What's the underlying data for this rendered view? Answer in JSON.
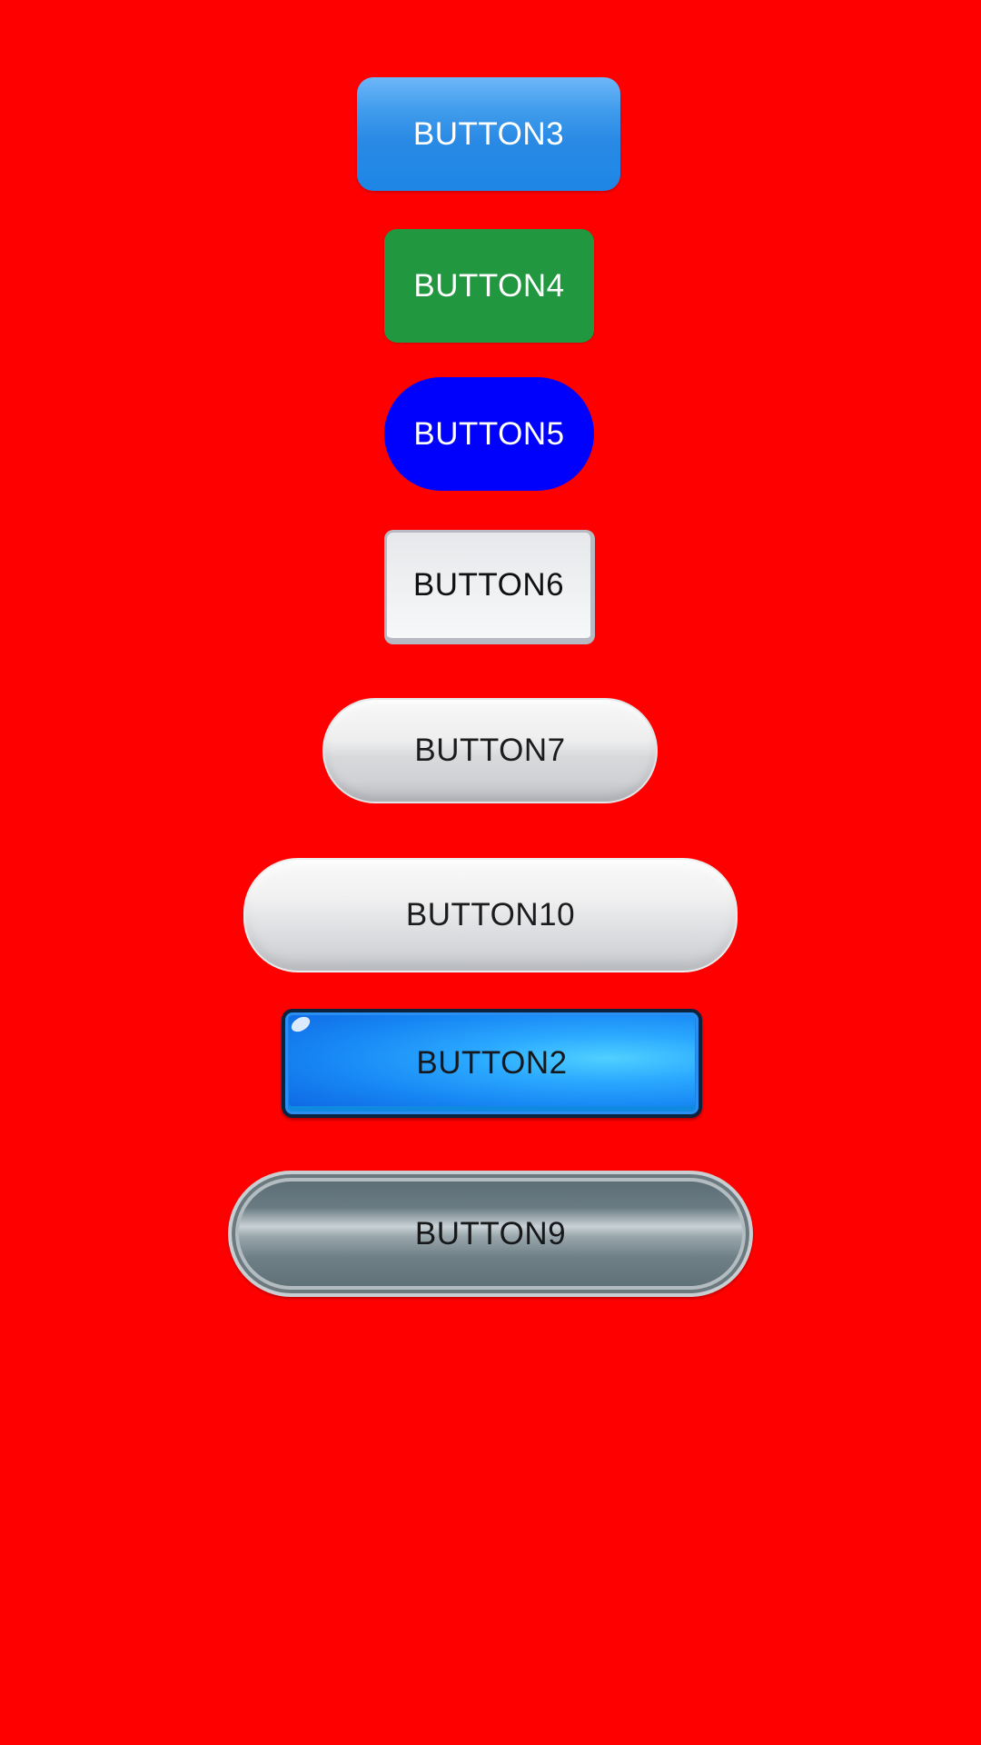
{
  "screen": {
    "background_color": "#ff0000"
  },
  "buttons": [
    {
      "id": "b3",
      "label": "BUTTON3",
      "color": "#2a8ae5"
    },
    {
      "id": "b4",
      "label": "BUTTON4",
      "color": "#21973f"
    },
    {
      "id": "b5",
      "label": "BUTTON5",
      "color": "#0000fd"
    },
    {
      "id": "b6",
      "label": "BUTTON6",
      "color": "#eef0f2"
    },
    {
      "id": "b7",
      "label": "BUTTON7",
      "color": "#eeeeef"
    },
    {
      "id": "b10",
      "label": "BUTTON10",
      "color": "#f0f0f1"
    },
    {
      "id": "b2",
      "label": "BUTTON2",
      "color": "#1684f3"
    },
    {
      "id": "b9",
      "label": "BUTTON9",
      "color": "#6a7b83"
    }
  ]
}
